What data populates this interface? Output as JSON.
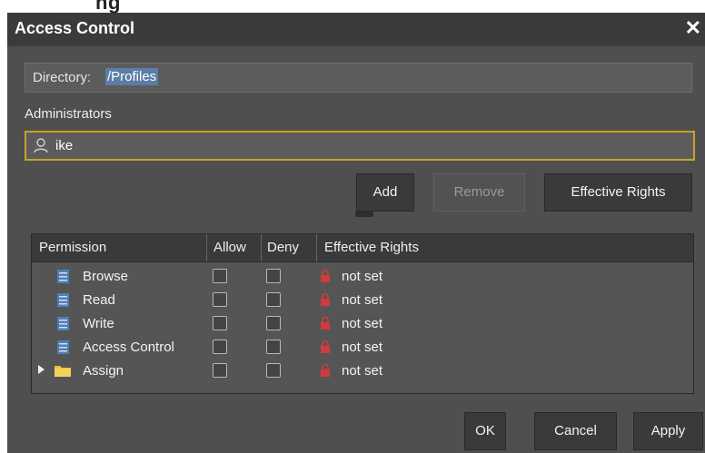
{
  "top_strip": {
    "text": "ng"
  },
  "dialog": {
    "title": "Access Control",
    "close": "✕"
  },
  "directory": {
    "label": "Directory:",
    "value": "/Profiles"
  },
  "administrators": {
    "label": "Administrators",
    "user": "ike"
  },
  "buttons": {
    "add": "Add",
    "remove": "Remove",
    "effective_rights": "Effective Rights"
  },
  "table": {
    "headers": {
      "permission": "Permission",
      "allow": "Allow",
      "deny": "Deny",
      "effective": "Effective Rights"
    },
    "rows": [
      {
        "label": "Browse",
        "effective": "not set",
        "type": "doc"
      },
      {
        "label": "Read",
        "effective": "not set",
        "type": "doc"
      },
      {
        "label": "Write",
        "effective": "not set",
        "type": "doc"
      },
      {
        "label": "Access Control",
        "effective": "not set",
        "type": "doc"
      },
      {
        "label": "Assign",
        "effective": "not set",
        "type": "folder"
      }
    ]
  },
  "footer": {
    "ok": "OK",
    "cancel": "Cancel",
    "apply": "Apply"
  },
  "colors": {
    "dialog_bg": "#4f4f4f",
    "focus_border": "#c9a227",
    "lock_red": "#d23b3b",
    "doc_icon": "#4f7fb8",
    "folder_yellow": "#e8c23a"
  }
}
